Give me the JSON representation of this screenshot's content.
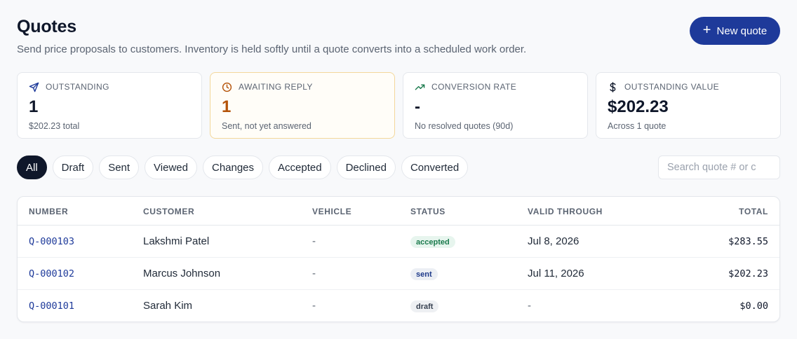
{
  "header": {
    "title": "Quotes",
    "subtitle": "Send price proposals to customers. Inventory is held softly until a quote converts into a scheduled work order.",
    "new_button_label": "New quote"
  },
  "stats": [
    {
      "icon": "send-icon",
      "label": "OUTSTANDING",
      "value": "1",
      "sub": "$202.23 total"
    },
    {
      "icon": "clock-icon",
      "label": "AWAITING REPLY",
      "value": "1",
      "sub": "Sent, not yet answered"
    },
    {
      "icon": "trending-up-icon",
      "label": "CONVERSION RATE",
      "value": "-",
      "sub": "No resolved quotes (90d)"
    },
    {
      "icon": "dollar-icon",
      "label": "OUTSTANDING VALUE",
      "value": "$202.23",
      "sub": "Across 1 quote"
    }
  ],
  "filters": {
    "selected": "All",
    "items": [
      "All",
      "Draft",
      "Sent",
      "Viewed",
      "Changes",
      "Accepted",
      "Declined",
      "Converted"
    ]
  },
  "search": {
    "placeholder": "Search quote # or c",
    "value": ""
  },
  "table": {
    "columns": [
      "NUMBER",
      "CUSTOMER",
      "VEHICLE",
      "STATUS",
      "VALID THROUGH",
      "TOTAL"
    ],
    "rows": [
      {
        "number": "Q-000103",
        "customer": "Lakshmi Patel",
        "vehicle": "-",
        "status": "accepted",
        "valid_through": "Jul 8, 2026",
        "total": "$283.55"
      },
      {
        "number": "Q-000102",
        "customer": "Marcus Johnson",
        "vehicle": "-",
        "status": "sent",
        "valid_through": "Jul 11, 2026",
        "total": "$202.23"
      },
      {
        "number": "Q-000101",
        "customer": "Sarah Kim",
        "vehicle": "-",
        "status": "draft",
        "valid_through": "-",
        "total": "$0.00"
      }
    ]
  },
  "colors": {
    "primary": "#1e3a9a",
    "awaiting_accent": "#b45309",
    "accepted_badge": "#1a7a4c",
    "active_chip": "#0f172a"
  }
}
